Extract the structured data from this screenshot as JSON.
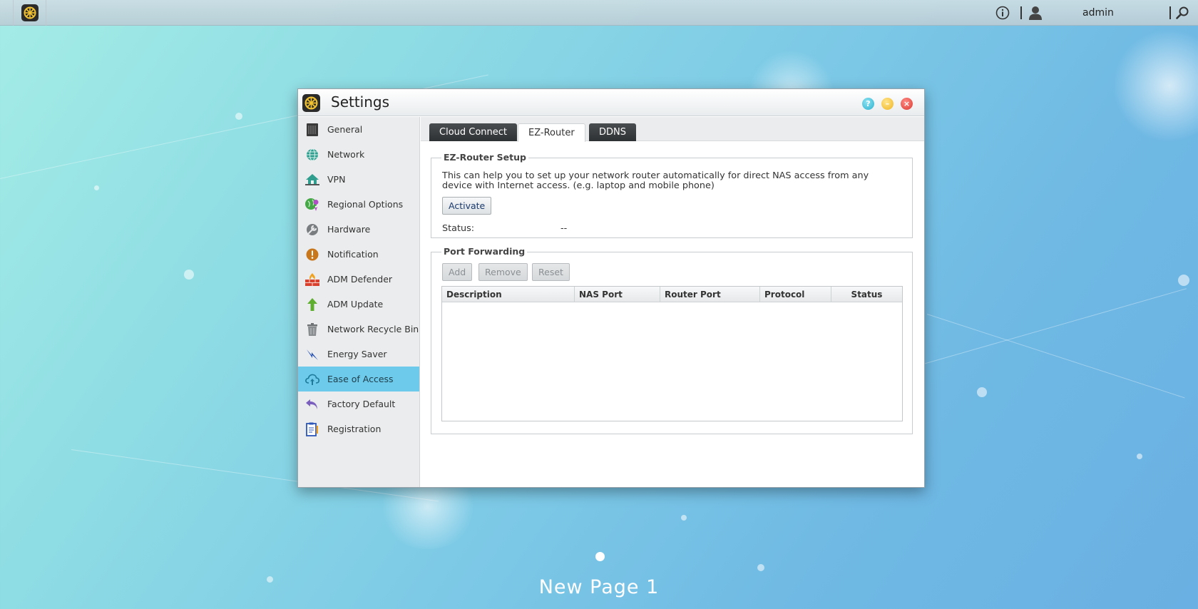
{
  "taskbar": {
    "launcher_icon": "settings-wheel-icon",
    "info_icon": "info-icon",
    "user_icon": "user-icon",
    "username": "admin",
    "search_icon": "search-icon"
  },
  "window": {
    "title": "Settings",
    "icon": "settings-wheel-icon",
    "controls": {
      "help": "?",
      "minimize": "–",
      "close": "×"
    }
  },
  "sidebar": {
    "items": [
      {
        "label": "General",
        "icon": "server-icon"
      },
      {
        "label": "Network",
        "icon": "globe-icon"
      },
      {
        "label": "VPN",
        "icon": "vpn-house-icon"
      },
      {
        "label": "Regional Options",
        "icon": "globe-pin-icon"
      },
      {
        "label": "Hardware",
        "icon": "wrench-icon"
      },
      {
        "label": "Notification",
        "icon": "alert-icon"
      },
      {
        "label": "ADM Defender",
        "icon": "firewall-icon"
      },
      {
        "label": "ADM Update",
        "icon": "arrow-up-icon"
      },
      {
        "label": "Network Recycle Bin",
        "icon": "trash-icon"
      },
      {
        "label": "Energy Saver",
        "icon": "lightning-icon"
      },
      {
        "label": "Ease of Access",
        "icon": "cloud-upload-icon"
      },
      {
        "label": "Factory Default",
        "icon": "undo-icon"
      },
      {
        "label": "Registration",
        "icon": "clipboard-icon"
      }
    ],
    "active": "Ease of Access"
  },
  "tabs": [
    {
      "label": "Cloud Connect"
    },
    {
      "label": "EZ-Router"
    },
    {
      "label": "DDNS"
    }
  ],
  "active_tab": "EZ-Router",
  "ez_router": {
    "legend": "EZ-Router Setup",
    "description": "This can help you to set up your network router automatically for direct NAS access from any device with Internet access. (e.g. laptop and mobile phone)",
    "activate_label": "Activate",
    "status_label": "Status:",
    "status_value": "--"
  },
  "port_forwarding": {
    "legend": "Port Forwarding",
    "add_label": "Add",
    "remove_label": "Remove",
    "reset_label": "Reset",
    "columns": [
      "Description",
      "NAS Port",
      "Router Port",
      "Protocol",
      "Status"
    ],
    "rows": []
  },
  "desktop": {
    "page_label": "New Page 1"
  }
}
